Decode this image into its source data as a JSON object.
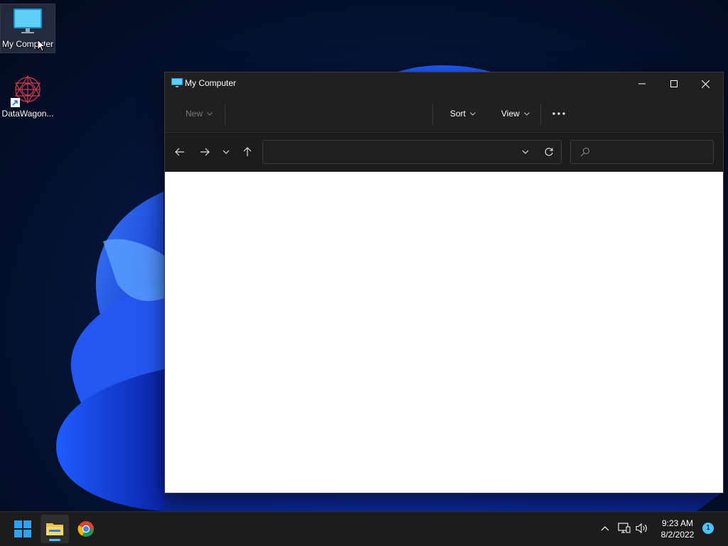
{
  "desktop": {
    "icons": [
      {
        "label": "My Computer",
        "icon": "monitor-icon",
        "selected": true
      },
      {
        "label": "DataWagon...",
        "icon": "datawagon-app-icon",
        "shortcut": true
      }
    ]
  },
  "window": {
    "title": "My Computer",
    "app_icon": "monitor-icon",
    "controls": {
      "minimize": "minimize-icon",
      "maximize": "maximize-icon",
      "close": "close-icon"
    },
    "command_bar": {
      "new_label": "New",
      "sort_label": "Sort",
      "view_label": "View",
      "more_icon": "more-options-icon"
    },
    "address_bar": {
      "back_icon": "arrow-left-icon",
      "forward_icon": "arrow-right-icon",
      "recent_icon": "chevron-down-icon",
      "up_icon": "arrow-up-icon",
      "path": "",
      "refresh_icon": "refresh-icon"
    },
    "search": {
      "placeholder": "",
      "icon": "search-icon"
    }
  },
  "taskbar": {
    "apps": [
      {
        "name": "start",
        "icon": "windows-start-icon"
      },
      {
        "name": "file-explorer",
        "icon": "folder-icon",
        "active": true
      },
      {
        "name": "chrome",
        "icon": "chrome-icon"
      }
    ],
    "tray": {
      "icons": [
        "chevron-up-icon",
        "network-icon",
        "volume-icon"
      ],
      "time": "9:23 AM",
      "date": "8/2/2022",
      "notification_count": "1"
    }
  },
  "colors": {
    "accent": "#4cc2ff",
    "window_bg": "#202020",
    "taskbar_bg": "#1c1c1c"
  }
}
